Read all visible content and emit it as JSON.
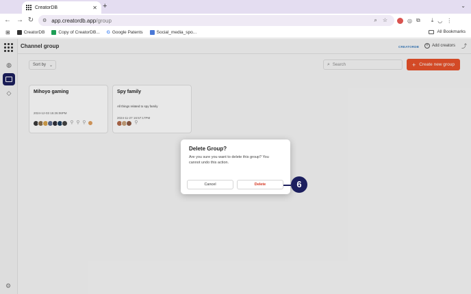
{
  "browser": {
    "tab_title": "CreatorDB",
    "url_host": "app.creatordb.app",
    "url_path": "/group",
    "bookmarks": [
      "CreatorDB",
      "Copy of CreatorDB...",
      "Google Patents",
      "Social_media_spo..."
    ],
    "all_bookmarks": "All Bookmarks"
  },
  "header": {
    "title": "Channel group",
    "brand": "CREATORDB",
    "add_creators": "Add creators"
  },
  "toolbar": {
    "sort_label": "Sort by",
    "search_placeholder": "Search",
    "create_label": "Create new group"
  },
  "groups": [
    {
      "name": "Mihoyo gaming",
      "description": "",
      "date": "2024-12-03 15:26:06PM",
      "avatar_colors": [
        "#3a3a3a",
        "#8b6f4e",
        "#d8a34b",
        "#5b6a8c",
        "#2f2f38",
        "#1f3f5f",
        "#444444"
      ],
      "ghost_count": 3,
      "extra_color": "#e0a060"
    },
    {
      "name": "Spy family",
      "description": "All things related to spy family",
      "date": "2024-11-27 16:57:17PM",
      "avatar_colors": [
        "#b36a4b",
        "#c9a27a",
        "#8d5a44"
      ],
      "ghost_count": 1,
      "extra_color": ""
    }
  ],
  "dialog": {
    "title": "Delete Group?",
    "body": "Are you sure you want to delete this group? You cannot undo this action.",
    "cancel_label": "Cancel",
    "delete_label": "Delete"
  },
  "step_badge": "6",
  "colors": {
    "accent": "#e8522a",
    "nav_active": "#1c1f5e",
    "delete_text": "#d4331d"
  }
}
